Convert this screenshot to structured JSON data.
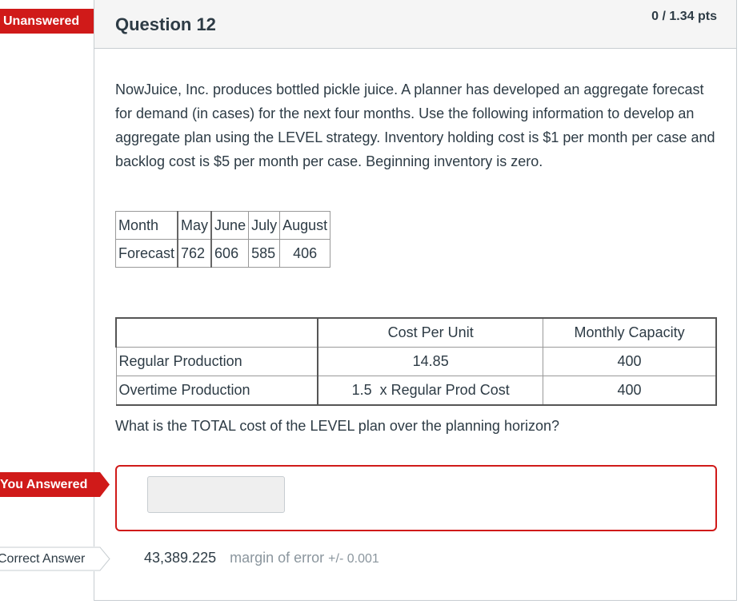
{
  "question": {
    "status_tag": "Unanswered",
    "title": "Question 12",
    "points": "0 / 1.34 pts",
    "text": "NowJuice, Inc. produces bottled pickle juice.  A planner has developed an aggregate forecast for demand (in cases) for the next four months.  Use the following information to develop an aggregate plan using the LEVEL strategy.  Inventory holding cost is $1 per month per case and backlog cost is $5 per month per case.  Beginning inventory is zero.",
    "prompt": "What is the TOTAL cost of the LEVEL plan over the planning horizon?"
  },
  "forecast_table": {
    "header": [
      "Month",
      "May",
      "June",
      "July",
      "August"
    ],
    "row": [
      "Forecast",
      "762",
      "606",
      "585",
      "406"
    ]
  },
  "cost_table": {
    "header": [
      "",
      "Cost Per Unit",
      "Monthly Capacity"
    ],
    "rows": [
      [
        "Regular Production",
        "14.85",
        "400"
      ],
      [
        "Overtime Production",
        "1.5  x Regular Prod Cost",
        "400"
      ]
    ]
  },
  "answer": {
    "you_answered_tag": "You Answered",
    "input_value": "",
    "correct_tag": "Correct Answer",
    "correct_value": "43,389.225",
    "margin_label": "margin of error",
    "margin_value": "+/- 0.001"
  },
  "colors": {
    "accent_red": "#d01a19",
    "header_bg": "#f5f5f5",
    "text": "#2d3b45",
    "muted": "#8b969e"
  }
}
